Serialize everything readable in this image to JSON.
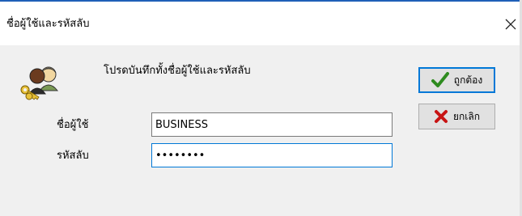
{
  "window": {
    "title": "ชื่อผู้ใช้และรหัสลับ",
    "close_icon": "close-icon"
  },
  "dialog": {
    "prompt": "โปรดบันทึกทั้งชื่อผู้ใช้และรหัสลับ",
    "app_icon": "users-keys-icon",
    "username_label": "ชื่อผู้ใช้",
    "username_value": "BUSINESS",
    "password_label": "รหัสลับ",
    "password_value": "••••••••"
  },
  "buttons": {
    "ok_label": "ถูกต้อง",
    "ok_icon": "checkmark-icon",
    "cancel_label": "ยกเลิก",
    "cancel_icon": "x-icon"
  },
  "colors": {
    "title_border": "#1f5fb8",
    "focus_border": "#0078d7",
    "check_green": "#2e8b1f",
    "cancel_red": "#c81414"
  }
}
